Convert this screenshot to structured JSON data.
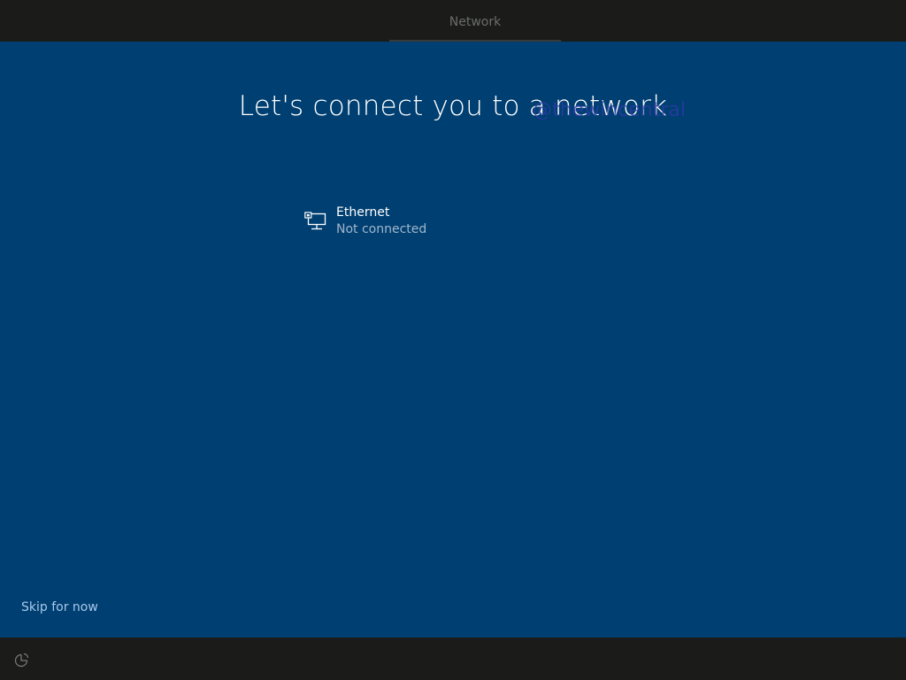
{
  "header": {
    "tab_label": "Network"
  },
  "main": {
    "title": "Let's connect you to a network",
    "watermark": "@thewincentral",
    "networks": [
      {
        "name": "Ethernet",
        "status": "Not connected",
        "icon": "ethernet-icon"
      }
    ],
    "skip_label": "Skip for now"
  },
  "footer": {
    "icon": "ease-of-access-icon"
  },
  "colors": {
    "background": "#003f71",
    "bars": "#1b1c1a",
    "link": "#a9c9ec",
    "status_text": "#9fb6cc"
  }
}
